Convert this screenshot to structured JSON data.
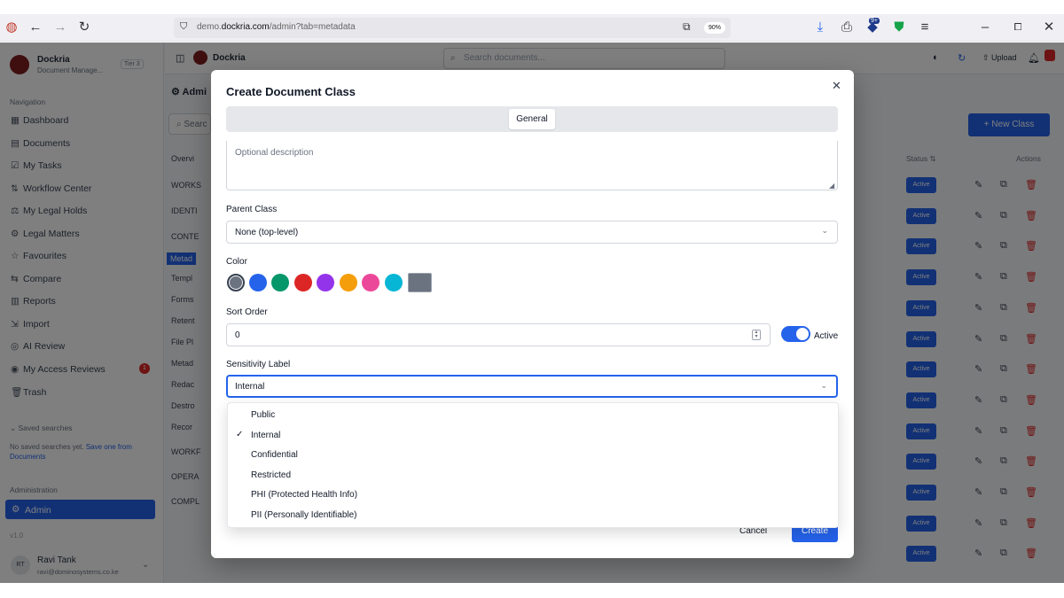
{
  "browser": {
    "url_prefix": "demo.",
    "url_domain": "dockria.com",
    "url_path": "/admin?tab=metadata",
    "zoom": "90%",
    "extension_badge": "9+"
  },
  "app": {
    "brand_name": "Dockria",
    "brand_sub": "Document Manage...",
    "brand_badge": "Tier 3",
    "topbar_name": "Dockria",
    "search_placeholder": "Search documents...",
    "upload_label": "Upload",
    "page_title": "Admi",
    "new_class_label": "New Class",
    "status_col": "Status",
    "actions_col": "Actions",
    "active_badge": "Active"
  },
  "sidebar": {
    "nav_heading": "Navigation",
    "items": [
      {
        "icon": "▦",
        "label": "Dashboard"
      },
      {
        "icon": "▤",
        "label": "Documents"
      },
      {
        "icon": "☑",
        "label": "My Tasks"
      },
      {
        "icon": "⇅",
        "label": "Workflow Center"
      },
      {
        "icon": "⚖",
        "label": "My Legal Holds"
      },
      {
        "icon": "⚙",
        "label": "Legal Matters"
      },
      {
        "icon": "☆",
        "label": "Favourites"
      },
      {
        "icon": "⇆",
        "label": "Compare"
      },
      {
        "icon": "▥",
        "label": "Reports"
      },
      {
        "icon": "⇲",
        "label": "Import"
      },
      {
        "icon": "◎",
        "label": "AI Review"
      },
      {
        "icon": "◉",
        "label": "My Access Reviews"
      },
      {
        "icon": "🗑",
        "label": "Trash"
      }
    ],
    "access_reviews_count": "1",
    "saved_searches_heading": "Saved searches",
    "saved_searches_empty": "No saved searches yet.",
    "saved_searches_link": "Save one from",
    "saved_searches_link2": "Documents",
    "admin_heading": "Administration",
    "admin_item": "Admin",
    "version": "v1.0",
    "user_initials": "RT",
    "user_name": "Ravi Tank",
    "user_email": "ravi@dominosystems.co.ke"
  },
  "subnav": {
    "search": "Searc",
    "items": [
      "Overvi",
      "WORKS",
      "IDENTI",
      "CONTE",
      "Metad",
      "Templ",
      "Forms",
      "Retent",
      "File Pl",
      "Metad",
      "Redac",
      "Destro",
      "Recor",
      "WORKF",
      "OPERA",
      "COMPL"
    ]
  },
  "modal": {
    "title": "Create Document Class",
    "tab_general": "General",
    "description_placeholder": "Optional description",
    "parent_label": "Parent Class",
    "parent_value": "None (top-level)",
    "color_label": "Color",
    "colors": [
      "#6b7280",
      "#2563eb",
      "#059669",
      "#dc2626",
      "#9333ea",
      "#f59e0b",
      "#ec4899",
      "#06b6d4"
    ],
    "custom_color": "#6b7280",
    "sort_label": "Sort Order",
    "sort_value": "0",
    "active_label": "Active",
    "active_on": true,
    "sensitivity_label": "Sensitivity Label",
    "sensitivity_value": "Internal",
    "cancel_label": "Cancel",
    "create_label": "Create"
  },
  "dropdown": {
    "options": [
      "Public",
      "Internal",
      "Confidential",
      "Restricted",
      "PHI (Protected Health Info)",
      "PII (Personally Identifiable)"
    ],
    "selected": "Internal"
  }
}
